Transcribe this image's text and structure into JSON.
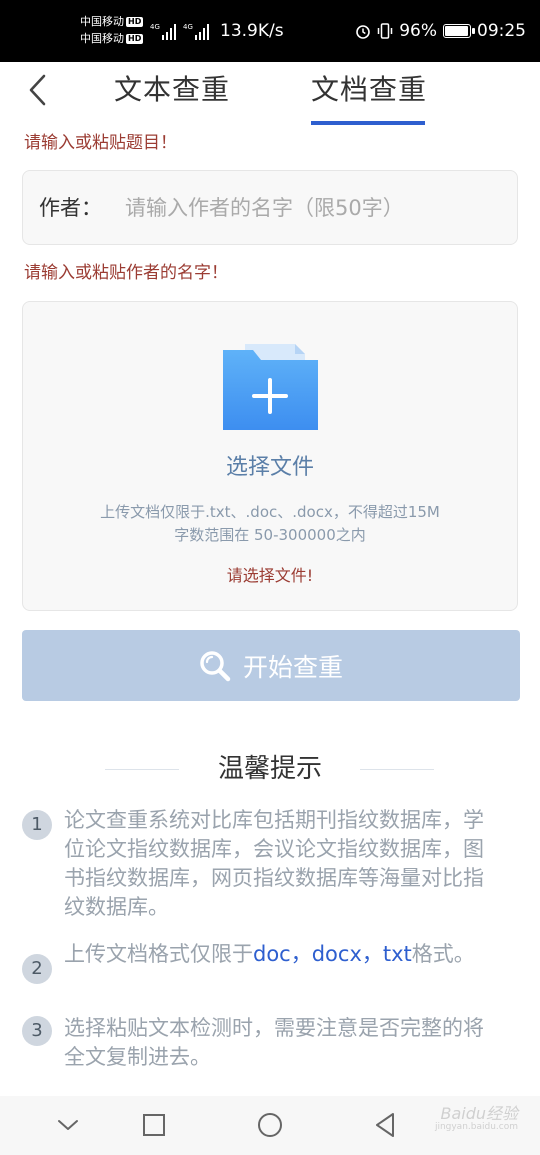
{
  "status_bar": {
    "carrier_1": "中国移动",
    "carrier_2": "中国移动",
    "hd_badge": "HD",
    "network_speed": "13.9K/s",
    "battery": "96%",
    "battery_level": 0.96,
    "time": "09:25"
  },
  "nav": {
    "tab_text": "文本查重",
    "tab_document": "文档查重",
    "active_tab": "文档查重"
  },
  "errors": {
    "title_required": "请输入或粘贴题目！",
    "author_required": "请输入或粘贴作者的名字！"
  },
  "author": {
    "label": "作者：",
    "placeholder": "请输入作者的名字（限50字）",
    "value": ""
  },
  "upload": {
    "choose_label": "选择文件",
    "hint_formats": "上传文档仅限于.txt、.doc、.docx，不得超过15M",
    "hint_range": "字数范围在 50-300000之内",
    "error": "请选择文件!"
  },
  "start_button": {
    "label": "开始查重"
  },
  "tips": {
    "title": "温馨提示",
    "items": [
      {
        "num": "1",
        "text": "论文查重系统对比库包括期刊指纹数据库，学位论文指纹数据库，会议论文指纹数据库，图书指纹数据库，网页指纹数据库等海量对比指纹数据库。"
      },
      {
        "num": "2",
        "prefix": "上传文档格式仅限于",
        "formats": "doc，docx，txt",
        "suffix": "格式。"
      },
      {
        "num": "3",
        "text": "选择粘贴文本检测时，需要注意是否完整的将全文复制进去。"
      }
    ]
  },
  "colors": {
    "accent": "#2e5fcf",
    "error": "#9b3c33",
    "button_disabled": "#b8cbe3",
    "folder_blue": "#4aa3f5"
  },
  "watermark": {
    "text": "Baidu经验",
    "sub": "jingyan.baidu.com"
  }
}
